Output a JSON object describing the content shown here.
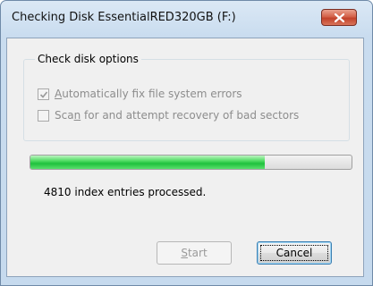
{
  "window": {
    "title": "Checking Disk EssentialRED320GB (F:)"
  },
  "options": {
    "group_label": "Check disk options",
    "items": [
      {
        "pre": "",
        "mnemonic": "A",
        "post": "utomatically fix file system errors",
        "checked": true,
        "enabled": false
      },
      {
        "pre": "Sca",
        "mnemonic": "n",
        "post": " for and attempt recovery of bad sectors",
        "checked": false,
        "enabled": false
      }
    ]
  },
  "progress": {
    "fraction": 0.73
  },
  "status": {
    "text": "4810 index entries processed."
  },
  "buttons": {
    "start": {
      "mnemonic": "S",
      "post": "tart",
      "enabled": false
    },
    "cancel": {
      "label": "Cancel",
      "enabled": true
    }
  },
  "colors": {
    "titlebar": "#dbe8f5",
    "close_button": "#c2422b",
    "progress_fill": "#1fc13d"
  },
  "icons": {
    "close": "close-icon",
    "check": "checkmark-icon"
  }
}
